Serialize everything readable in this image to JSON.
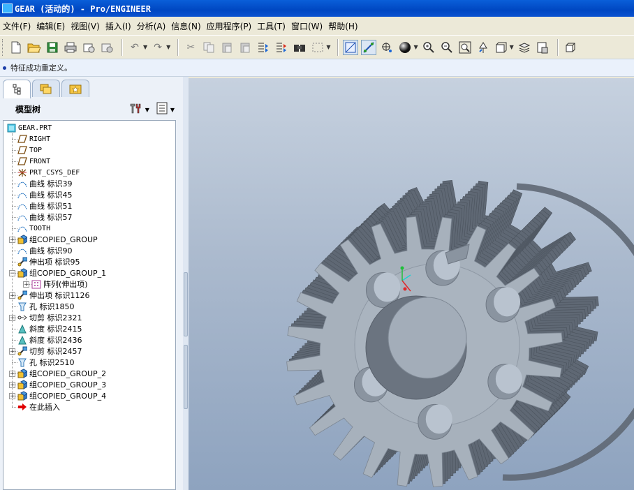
{
  "window": {
    "title": "GEAR (活动的) - Pro/ENGINEER"
  },
  "menu": [
    {
      "label": "文件(F)"
    },
    {
      "label": "编辑(E)"
    },
    {
      "label": "视图(V)"
    },
    {
      "label": "插入(I)"
    },
    {
      "label": "分析(A)"
    },
    {
      "label": "信息(N)"
    },
    {
      "label": "应用程序(P)"
    },
    {
      "label": "工具(T)"
    },
    {
      "label": "窗口(W)"
    },
    {
      "label": "帮助(H)"
    }
  ],
  "toolbar_icons": [
    "new-icon",
    "open-icon",
    "save-icon",
    "print-icon",
    "send-mail-icon",
    "send-icon",
    "undo-icon",
    "redo-icon",
    "cut-icon",
    "copy-icon",
    "paste-icon",
    "paste-special-icon",
    "regenerate-icon",
    "regenerate-manager-icon",
    "find-icon",
    "select-box-icon",
    "datum-plane-display-icon",
    "datum-axis-display-icon",
    "point-display-icon",
    "shading-sphere-icon",
    "zoom-in-icon",
    "zoom-out-icon",
    "refit-icon",
    "reorient-icon",
    "saved-views-icon",
    "layers-icon",
    "view-manager-icon",
    "spin-center-icon"
  ],
  "status": {
    "message": "特征成功重定义。"
  },
  "panel": {
    "title": "模型树",
    "tabs": [
      "model-tree-tab",
      "folder-browser-tab",
      "favorites-tab"
    ]
  },
  "tree": [
    {
      "label": "GEAR.PRT",
      "icon": "part-icon",
      "mono": true
    },
    {
      "label": "RIGHT",
      "icon": "datum-plane-icon",
      "mono": true
    },
    {
      "label": "TOP",
      "icon": "datum-plane-icon",
      "mono": true
    },
    {
      "label": "FRONT",
      "icon": "datum-plane-icon",
      "mono": true
    },
    {
      "label": "PRT_CSYS_DEF",
      "icon": "csys-icon",
      "mono": true
    },
    {
      "label": "曲线 标识39",
      "icon": "curve-icon"
    },
    {
      "label": "曲线 标识45",
      "icon": "curve-icon"
    },
    {
      "label": "曲线 标识51",
      "icon": "curve-icon"
    },
    {
      "label": "曲线 标识57",
      "icon": "curve-icon"
    },
    {
      "label": "TOOTH",
      "icon": "curve-icon",
      "mono": true
    },
    {
      "label": "组COPIED_GROUP",
      "icon": "group-icon",
      "expander": "+"
    },
    {
      "label": "曲线 标识90",
      "icon": "curve-icon"
    },
    {
      "label": "伸出项 标识95",
      "icon": "protrusion-icon"
    },
    {
      "label": "组COPIED_GROUP_1",
      "icon": "group-icon",
      "expander": "-"
    },
    {
      "label": "阵列(伸出项)",
      "icon": "pattern-icon",
      "expander": "+",
      "indent": 1
    },
    {
      "label": "伸出项 标识1126",
      "icon": "protrusion-icon",
      "expander": "+"
    },
    {
      "label": "孔 标识1850",
      "icon": "hole-icon"
    },
    {
      "label": "切剪 标识2321",
      "icon": "cut-feature-icon",
      "expander": "+"
    },
    {
      "label": "斜度 标识2415",
      "icon": "draft-icon"
    },
    {
      "label": "斜度 标识2436",
      "icon": "draft-icon"
    },
    {
      "label": "切剪 标识2457",
      "icon": "protrusion-icon",
      "expander": "+"
    },
    {
      "label": "孔 标识2510",
      "icon": "hole-icon"
    },
    {
      "label": "组COPIED_GROUP_2",
      "icon": "group-icon",
      "expander": "+"
    },
    {
      "label": "组COPIED_GROUP_3",
      "icon": "group-icon",
      "expander": "+"
    },
    {
      "label": "组COPIED_GROUP_4",
      "icon": "group-icon",
      "expander": "+"
    },
    {
      "label": "在此插入",
      "icon": "insert-here-arrow-icon"
    }
  ],
  "colors": {
    "titlebar": "#0a52d0",
    "viewport_top": "#c6d1df",
    "viewport_bottom": "#8ea3bf",
    "gear_face": "#a7b1bc",
    "gear_side": "#5f6874",
    "insert_arrow": "#e00000"
  },
  "model": {
    "name": "gear",
    "tooth_count": 24
  }
}
